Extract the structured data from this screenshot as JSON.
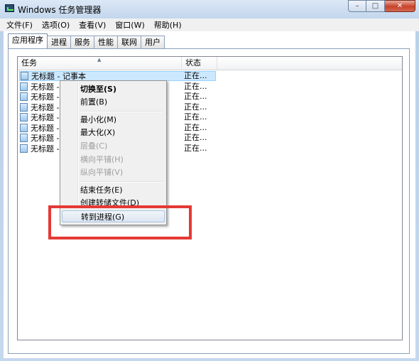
{
  "window": {
    "title": "Windows 任务管理器",
    "min_glyph": "–",
    "max_glyph": "□",
    "close_glyph": "✕"
  },
  "menubar": [
    "文件(F)",
    "选项(O)",
    "查看(V)",
    "窗口(W)",
    "帮助(H)"
  ],
  "tabs": [
    {
      "label": "应用程序",
      "active": true
    },
    {
      "label": "进程",
      "active": false
    },
    {
      "label": "服务",
      "active": false
    },
    {
      "label": "性能",
      "active": false
    },
    {
      "label": "联网",
      "active": false
    },
    {
      "label": "用户",
      "active": false
    }
  ],
  "table": {
    "columns": [
      "任务",
      "状态"
    ],
    "sort_indicator": "▲",
    "rows": [
      {
        "task": "无标题 - 记事本",
        "status": "正在..."
      },
      {
        "task": "无标题 -",
        "status": "正在..."
      },
      {
        "task": "无标题 -",
        "status": "正在..."
      },
      {
        "task": "无标题 -",
        "status": "正在..."
      },
      {
        "task": "无标题 -",
        "status": "正在..."
      },
      {
        "task": "无标题 -",
        "status": "正在..."
      },
      {
        "task": "无标题 -",
        "status": "正在..."
      },
      {
        "task": "无标题 -",
        "status": "正在..."
      }
    ]
  },
  "context_menu": {
    "items": [
      {
        "label": "切换至(S)",
        "bold": true,
        "disabled": false
      },
      {
        "label": "前置(B)",
        "bold": false,
        "disabled": false
      },
      {
        "label": "最小化(M)",
        "bold": false,
        "disabled": false
      },
      {
        "label": "最大化(X)",
        "bold": false,
        "disabled": false
      },
      {
        "label": "层叠(C)",
        "bold": false,
        "disabled": true
      },
      {
        "label": "横向平铺(H)",
        "bold": false,
        "disabled": true
      },
      {
        "label": "纵向平铺(V)",
        "bold": false,
        "disabled": true
      },
      {
        "label": "结束任务(E)",
        "bold": false,
        "disabled": false
      },
      {
        "label": "创建转储文件(D)",
        "bold": false,
        "disabled": false
      },
      {
        "label": "转到进程(G)",
        "bold": false,
        "disabled": false,
        "hover": true
      }
    ]
  },
  "colors": {
    "highlight_box": "#e53935",
    "selection": "#cce8ff"
  }
}
